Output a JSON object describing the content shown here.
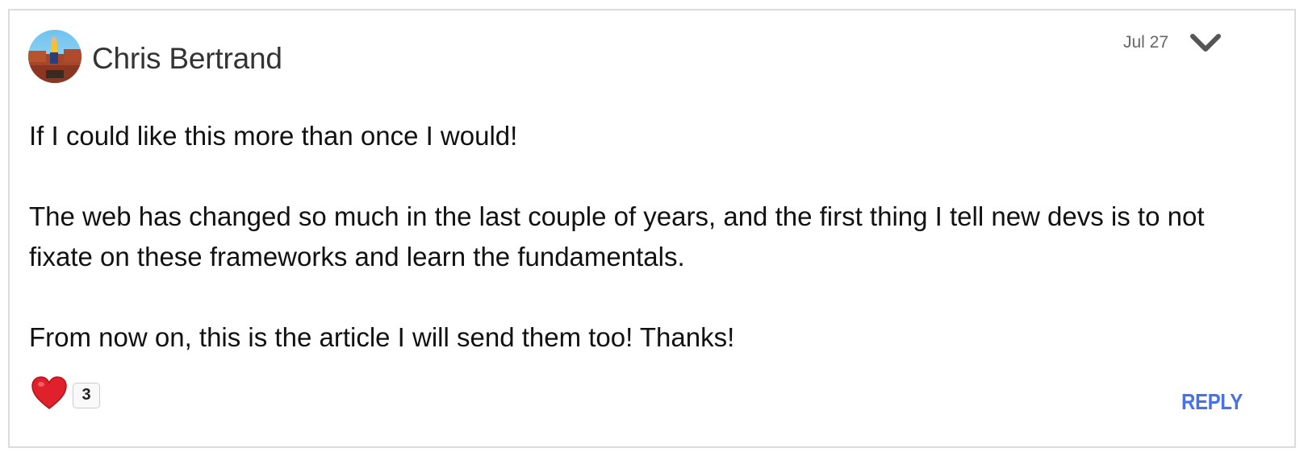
{
  "comment": {
    "author": "Chris Bertrand",
    "date": "Jul 27",
    "body": [
      "If I could like this more than once I would!",
      "The web has changed so much in the last couple of years, and the first thing I tell new devs is to not fixate on these frameworks and learn the fundamentals.",
      "From now on, this is the article I will send them too! Thanks!"
    ],
    "like_count": "3",
    "reply_label": "REPLY",
    "icons": {
      "avatar": "avatar",
      "menu": "chevron-down-icon",
      "like": "heart-icon"
    },
    "colors": {
      "reply": "#4a72e8",
      "heart": "#e0202b",
      "border": "#dcdcdc"
    }
  }
}
